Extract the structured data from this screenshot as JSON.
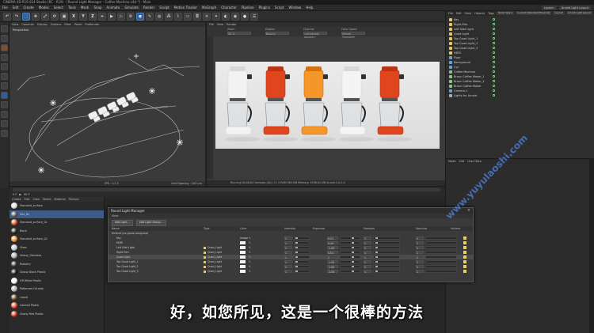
{
  "titlebar": {
    "text": "CINEMA 4D R19.024 Studio (RC - R19) - [Round Light Manager - Coffee Machine.c4d *] - Main"
  },
  "menubar": {
    "items": [
      "File",
      "Edit",
      "Create",
      "Modes",
      "Select",
      "Tools",
      "Mesh",
      "Snap",
      "Animate",
      "Simulate",
      "Render",
      "Sculpt",
      "Motion Tracker",
      "MoGraph",
      "Character",
      "Pipeline",
      "Plugins",
      "Script",
      "Window",
      "Help"
    ],
    "layout_label": "Layout:",
    "layout_value": "Arnold Light Layout"
  },
  "toolbar": {
    "x_label": "X",
    "y_label": "Y",
    "z_label": "Z"
  },
  "viewport": {
    "tabs": [
      "View",
      "Cameras",
      "Display",
      "Options",
      "Filter",
      "Panel",
      "ProRender"
    ],
    "perspective_label": "Perspective",
    "footer_left": "FPS : 17.3",
    "footer_right": "Grid Spacing : 100 cm"
  },
  "render_view": {
    "tabs": [
      "File",
      "View",
      "Render"
    ],
    "option_labels": [
      "Zoom",
      "Display",
      "Channel",
      "Color Space"
    ],
    "option_values": [
      "50 %",
      "Beauty",
      "<all beauty passes>",
      "Viewer Transform"
    ],
    "status_text": "Running  00:00:05  Samples (AA): 3 / 5  RAM 984 MB  Memory: 2396.81 MB  Arnold 5.0.2.0"
  },
  "timeline": {
    "start_frame": "0 F",
    "end_frame": "90 F"
  },
  "object_manager": {
    "tabs": [
      "File",
      "Edit",
      "View",
      "Objects",
      "Tags",
      "Bookmarks"
    ],
    "top_buttons": [
      "Node Space",
      "Current (Standard/Physical)",
      "Layout",
      "Arnold Light Layout"
    ],
    "objects": [
      {
        "name": "Key",
        "color": "#e8c860"
      },
      {
        "name": "Right Rim",
        "color": "#e8c860"
      },
      {
        "name": "Left Side Light",
        "color": "#e8c860"
      },
      {
        "name": "Quad Light",
        "color": "#e8c860"
      },
      {
        "name": "Top Quad Light_1",
        "color": "#e8c860"
      },
      {
        "name": "Top Quad Light_2",
        "color": "#e8c860"
      },
      {
        "name": "Top Quad Light_3",
        "color": "#e8c860"
      },
      {
        "name": "HDRI",
        "color": "#e8c860"
      },
      {
        "name": "Floor",
        "color": "#6aa0d8"
      },
      {
        "name": "Background",
        "color": "#6aa0d8"
      },
      {
        "name": "Cyc",
        "color": "#6aa0d8"
      },
      {
        "name": "Coffee Machine",
        "color": "#8fc08f"
      },
      {
        "name": "Braun Coffee Maker_1",
        "color": "#8fc08f"
      },
      {
        "name": "Braun Coffee Maker_2",
        "color": "#8fc08f"
      },
      {
        "name": "Braun Coffee Maker",
        "color": "#8fc08f"
      },
      {
        "name": "Camera.1",
        "color": "#6aa0d8"
      },
      {
        "name": "Lights for Arnold",
        "color": "#aaaaaa"
      }
    ]
  },
  "attributes": {
    "tabs": [
      "Mode",
      "Edit",
      "User Data"
    ]
  },
  "material_manager": {
    "tabs": [
      "Create",
      "Edit",
      "View",
      "Select",
      "Material",
      "Texture"
    ],
    "materials": [
      {
        "name": "Standard_surface",
        "color": "#dddddd"
      },
      {
        "name": "Mat_Dk",
        "color": "#555555"
      },
      {
        "name": "Standard_surface_01",
        "color": "#e05030"
      },
      {
        "name": "Black",
        "color": "#222222"
      },
      {
        "name": "Standard_surface_02",
        "color": "#f09030"
      },
      {
        "name": "Glass",
        "color": "#c0c8d0"
      },
      {
        "name": "Glossy_Stainless",
        "color": "#a8a8a8"
      },
      {
        "name": "Rubbery",
        "color": "#333333"
      },
      {
        "name": "Glossy Black Plastic",
        "color": "#1a1a1a"
      },
      {
        "name": "Off White Plastic",
        "color": "#eeeeee"
      },
      {
        "name": "Patterned Chrome",
        "color": "#b0b0b0"
      },
      {
        "name": "Liquid",
        "color": "#6a4020"
      },
      {
        "name": "Colored Plastic",
        "color": "#e84a2a"
      },
      {
        "name": "Glossy Red Plastic",
        "color": "#d03020"
      }
    ]
  },
  "light_manager": {
    "title": "Round Light Manager",
    "view_label": "View",
    "buttons": [
      "Add Light...",
      "Add Light Group..."
    ],
    "headers": [
      "Name",
      "Type",
      "Color",
      "Intensity",
      "Exposure",
      "Samples",
      "Specular",
      "Volume"
    ],
    "group_label": "Default (no group assigned)",
    "lights": [
      {
        "name": "Key",
        "type": "",
        "color_label": "Image",
        "intensity": "1",
        "exposure": "0.01",
        "samples": "1",
        "specular": "1"
      },
      {
        "name": "HDRI",
        "type": "",
        "color_label": "",
        "intensity": "1",
        "exposure": "0.00",
        "samples": "1",
        "specular": "1"
      },
      {
        "name": "Left Side Light",
        "type": "Quad_Light",
        "color_label": "",
        "intensity": "1",
        "exposure": "-1.00",
        "samples": "1",
        "specular": "1"
      },
      {
        "name": "Right Rim",
        "type": "Quad_Light",
        "color_label": "",
        "intensity": "1",
        "exposure": "0.01",
        "samples": "1",
        "specular": "1"
      },
      {
        "name": "Quad Light",
        "type": "Quad_Light",
        "color_label": "",
        "intensity": "1",
        "exposure": "2",
        "samples": "1",
        "specular": "1"
      },
      {
        "name": "Top Quad Light_1",
        "type": "Quad_Light",
        "color_label": "",
        "intensity": "1",
        "exposure": "-1.00",
        "samples": "1",
        "specular": "1"
      },
      {
        "name": "Top Quad Light_2",
        "type": "Quad_Light",
        "color_label": "",
        "intensity": "1",
        "exposure": "-1.00",
        "samples": "1",
        "specular": "1"
      },
      {
        "name": "Top Quad Light_3",
        "type": "Quad_Light",
        "color_label": "",
        "intensity": "1",
        "exposure": "-1.00",
        "samples": "1",
        "specular": "1"
      }
    ]
  },
  "render_image": {
    "machines": [
      {
        "color": "#f2f2f2",
        "accent": "#d8d8d8"
      },
      {
        "color": "#e0461e",
        "accent": "#b83412"
      },
      {
        "color": "#f5962a",
        "accent": "#d27210"
      },
      {
        "color": "#f4f4f4",
        "accent": "#d8d8d8"
      },
      {
        "color": "#e0461e",
        "accent": "#b83412"
      }
    ]
  },
  "watermark": "www.yuyulaoshi.com",
  "subtitle": "好，如您所见，这是一个很棒的方法"
}
